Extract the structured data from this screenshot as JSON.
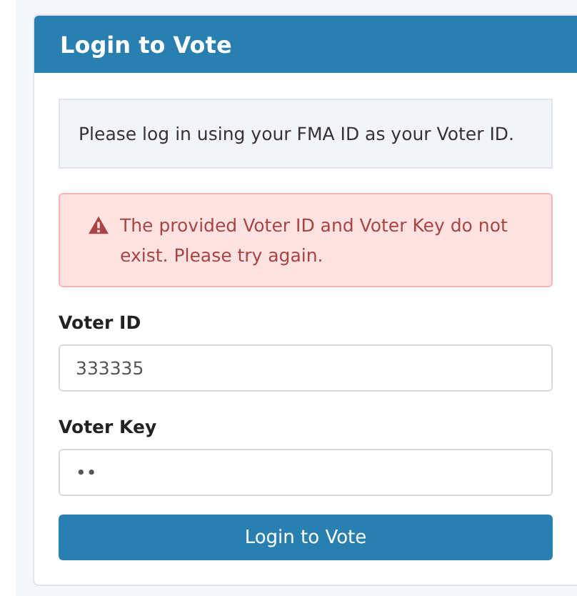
{
  "panel": {
    "title": "Login to Vote"
  },
  "info": "Please log in using your FMA ID as your Voter ID.",
  "alert": {
    "kind": "error",
    "text": "The provided Voter ID and Voter Key do not exist. Please try again."
  },
  "fields": [
    {
      "label": "Voter ID",
      "value": "333335"
    },
    {
      "label": "Voter Key",
      "value": "••"
    }
  ],
  "button": "Login to Vote"
}
